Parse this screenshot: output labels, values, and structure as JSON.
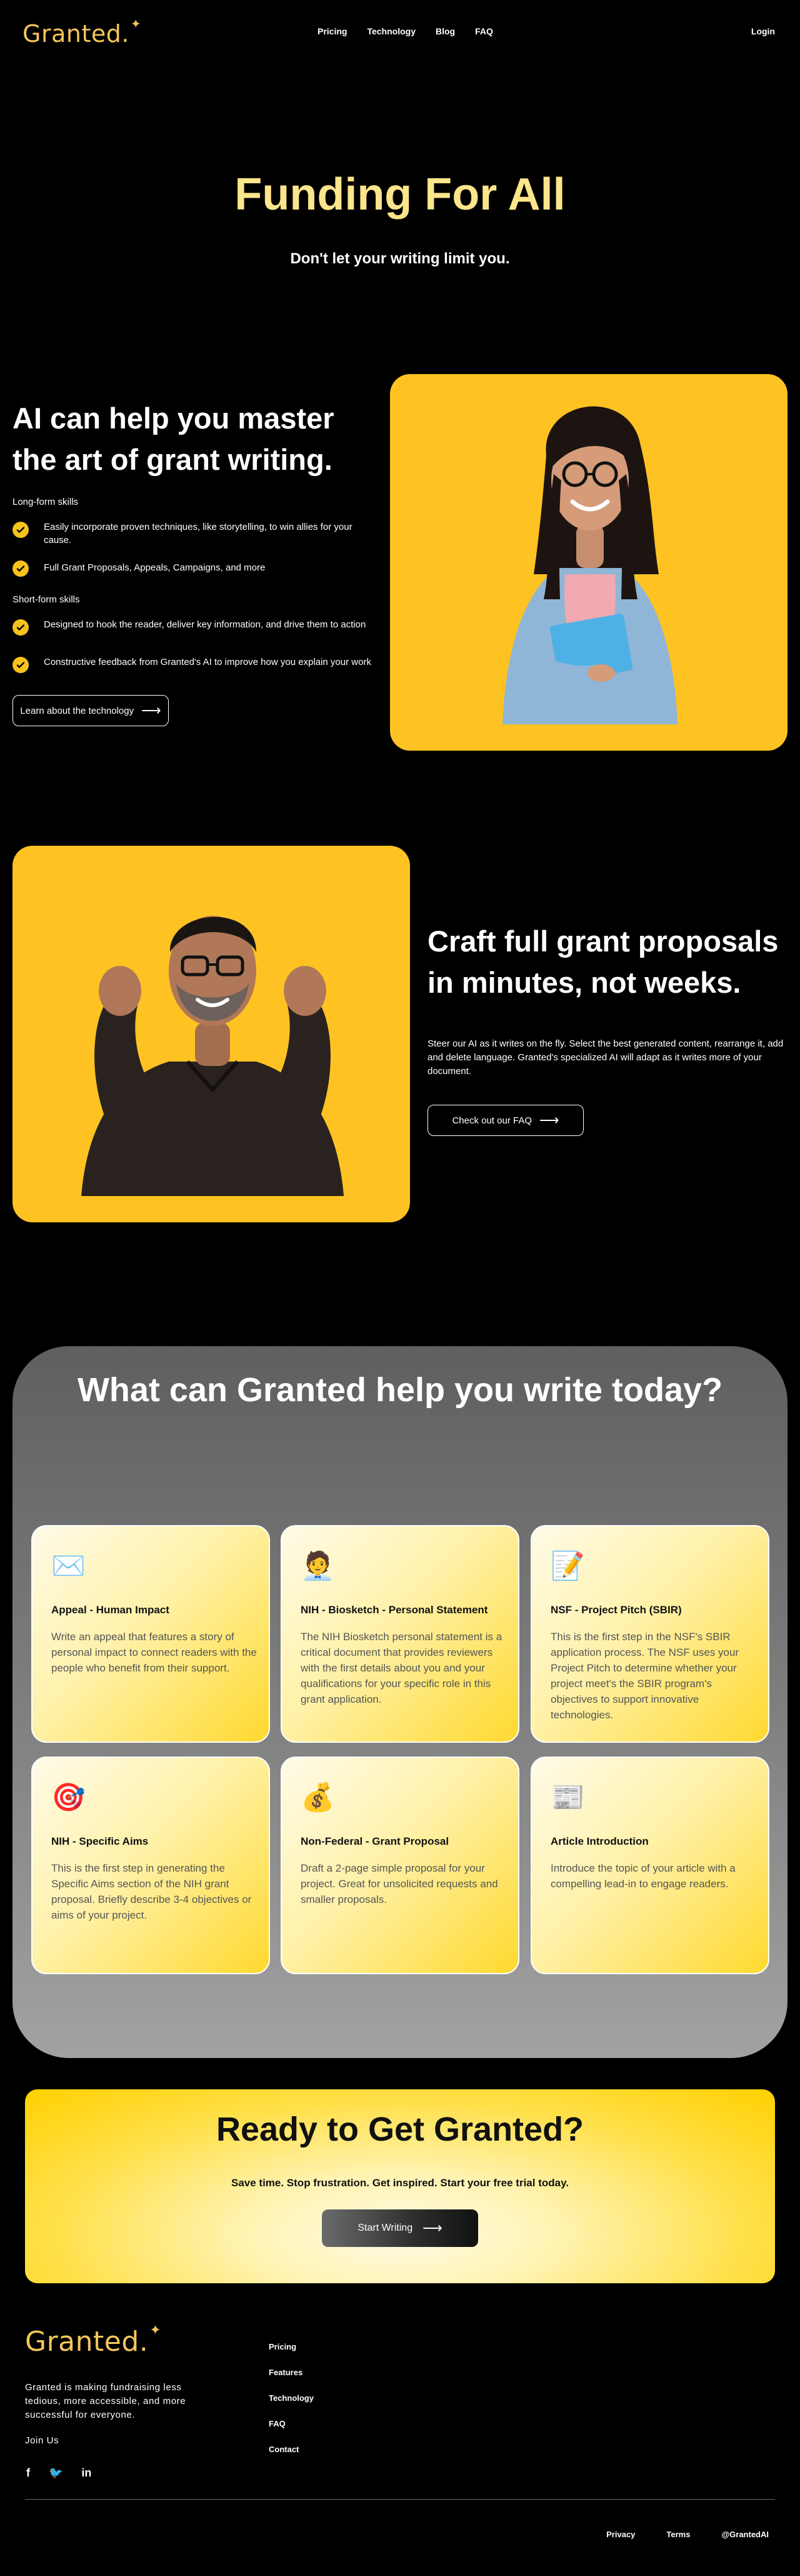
{
  "nav": {
    "logo": "Granted.",
    "links": [
      "Pricing",
      "Technology",
      "Blog",
      "FAQ"
    ],
    "login": "Login"
  },
  "hero": {
    "title": "Funding For All",
    "subtitle": "Don't let your writing limit you."
  },
  "section1": {
    "heading": "AI can help you master the art of grant writing.",
    "long_form_label": "Long-form skills",
    "long_form_items": [
      "Easily incorporate proven techniques, like storytelling, to win allies for your cause.",
      "Full Grant Proposals, Appeals, Campaigns, and more"
    ],
    "short_form_label": "Short-form skills",
    "short_form_items": [
      "Designed to hook the reader, deliver key information, and drive them to action",
      "Constructive feedback from Granted's AI to improve how you explain your work"
    ],
    "button": "Learn about the technology"
  },
  "section2": {
    "heading": "Craft full grant proposals in minutes, not weeks.",
    "description": "Steer our AI as it writes on the fly. Select the best generated content, rearrange it, add and delete language. Granted's specialized AI will adapt as it writes more of your document.",
    "button": "Check out our FAQ"
  },
  "section3": {
    "heading": "What can Granted help you write today?",
    "cards": [
      {
        "icon": "envelope-icon",
        "emoji": "✉️",
        "title": "Appeal - Human Impact",
        "desc": "Write an appeal that features a story of personal impact to connect readers with the people who benefit from their support."
      },
      {
        "icon": "office-worker-icon",
        "emoji": "🧑‍💼",
        "title": "NIH - Biosketch - Personal Statement",
        "desc": "The NIH Biosketch personal statement is a critical document that provides reviewers with the first details about you and your qualifications for your specific role in this grant application."
      },
      {
        "icon": "memo-icon",
        "emoji": "📝",
        "title": "NSF - Project Pitch (SBIR)",
        "desc": "This is the first step in the NSF's SBIR application process. The NSF uses your Project Pitch to determine whether your project meet's the SBIR program's objectives to support innovative technologies."
      },
      {
        "icon": "target-icon",
        "emoji": "🎯",
        "title": "NIH - Specific Aims",
        "desc": "This is the first step in generating the Specific Aims section of the NIH grant proposal. Briefly describe 3-4 objectives or aims of your project."
      },
      {
        "icon": "money-bag-icon",
        "emoji": "💰",
        "title": "Non-Federal - Grant Proposal",
        "desc": "Draft a 2-page simple proposal for your project. Great for unsolicited requests and smaller proposals."
      },
      {
        "icon": "newspaper-icon",
        "emoji": "📰",
        "title": "Article Introduction",
        "desc": "Introduce the topic of your article with a compelling lead-in to engage readers."
      }
    ]
  },
  "cta": {
    "title": "Ready to Get Granted?",
    "subtitle": "Save time. Stop frustration. Get inspired. Start your free trial today.",
    "button": "Start Writing"
  },
  "footer": {
    "logo": "Granted.",
    "description": "Granted is making fundraising less tedious, more accessible, and more successful for everyone.",
    "join": "Join Us",
    "social": [
      "facebook-icon",
      "twitter-icon",
      "linkedin-icon"
    ],
    "social_glyphs": [
      "f",
      "🐦",
      "in"
    ],
    "links": [
      "Pricing",
      "Features",
      "Technology",
      "FAQ",
      "Contact"
    ],
    "bottom": [
      "Privacy",
      "Terms",
      "@GrantedAI"
    ]
  },
  "colors": {
    "accent_yellow": "#FEC322",
    "logo_gold": "#F3C65A",
    "hero_title": "#FCE58A"
  }
}
